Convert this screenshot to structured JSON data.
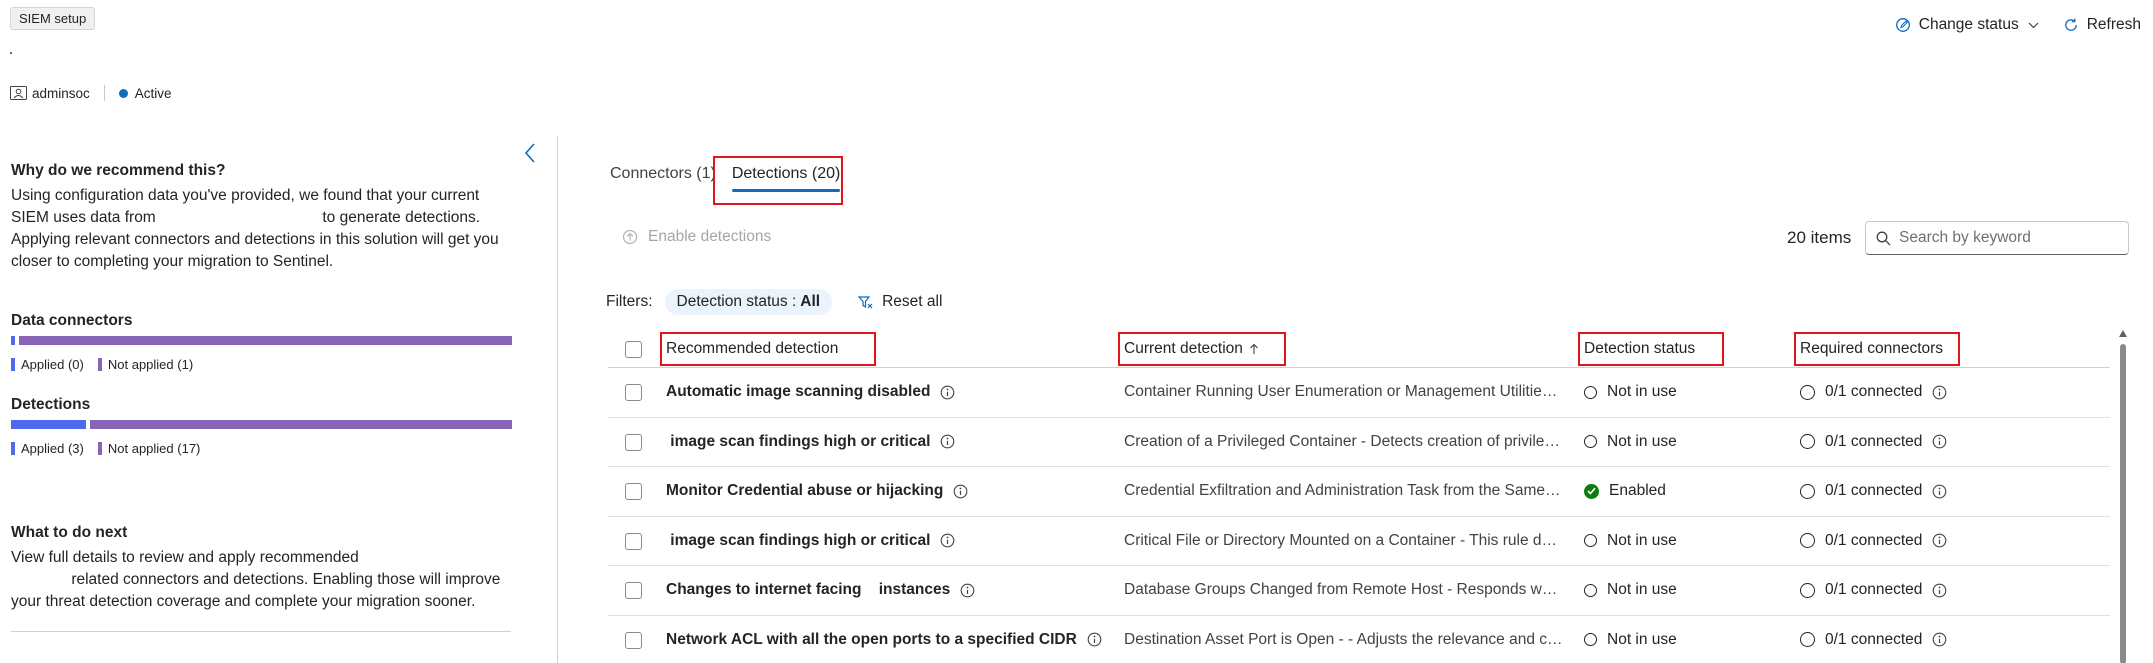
{
  "header": {
    "chip_label": "SIEM setup",
    "owner": "adminsoc",
    "status": "Active",
    "actions": {
      "change_status": "Change status",
      "refresh": "Refresh"
    }
  },
  "left_panel": {
    "why_heading": "Why do we recommend this?",
    "why_text_1": "Using configuration data you've provided, we found that your current SIEM uses data from",
    "why_text_2": "to generate detections. Applying relevant connectors and detections in this solution will get you closer to completing your migration to Sentinel.",
    "data_connectors": {
      "heading": "Data connectors",
      "applied_label": "Applied (0)",
      "not_applied_label": "Not applied (1)",
      "applied": 0,
      "not_applied": 1
    },
    "detections": {
      "heading": "Detections",
      "applied_label": "Applied (3)",
      "not_applied_label": "Not applied (17)",
      "applied": 3,
      "not_applied": 17
    },
    "next_heading": "What to do next",
    "next_text_1": "View full details to review and apply recommended",
    "next_text_2": "related connectors and detections. Enabling those will improve your threat detection coverage and complete your migration sooner."
  },
  "tabs": [
    {
      "label": "Connectors (1)",
      "active": false
    },
    {
      "label": "Detections (20)",
      "active": true
    }
  ],
  "toolbar": {
    "enable_label": "Enable detections",
    "items_count": "20 items",
    "search_placeholder": "Search by keyword"
  },
  "filters": {
    "label": "Filters:",
    "pill_key": "Detection status :",
    "pill_value": "All",
    "reset_label": "Reset all"
  },
  "table": {
    "columns": {
      "recommended": "Recommended detection",
      "current": "Current detection",
      "status": "Detection status",
      "required": "Required connectors"
    },
    "rows": [
      {
        "recommended": "Automatic image scanning disabled",
        "current": "Container Running User Enumeration or Management Utilities - Detects container running user enumeration or management utilities",
        "status": "Not in use",
        "enabled": false,
        "required": "0/1 connected"
      },
      {
        "recommended": " image scan findings high or critical",
        "current": "Creation of a Privileged Container - Detects creation of privileged containers",
        "status": "Not in use",
        "enabled": false,
        "required": "0/1 connected"
      },
      {
        "recommended": "Monitor Credential abuse or hijacking",
        "current": "Credential Exfiltration and Administration Task from the Same Host",
        "status": "Enabled",
        "enabled": true,
        "required": "0/1 connected"
      },
      {
        "recommended": " image scan findings high or critical",
        "current": "Critical File or Directory Mounted on a Container - This rule detects",
        "status": "Not in use",
        "enabled": false,
        "required": "0/1 connected"
      },
      {
        "recommended": "Changes to internet facing    instances",
        "current": "Database Groups Changed from Remote Host - Responds when database groups change",
        "status": "Not in use",
        "enabled": false,
        "required": "0/1 connected"
      },
      {
        "recommended": "Network ACL with all the open ports to a specified CIDR",
        "current": "Destination Asset Port is Open - - Adjusts the relevance and credibility",
        "status": "Not in use",
        "enabled": false,
        "required": "0/1 connected"
      }
    ]
  },
  "colors": {
    "accent": "#0f6cbd",
    "applied_bar": "#4f6bed",
    "not_applied_bar": "#8764b8",
    "highlight_box": "#e3151a",
    "enabled_green": "#107c10"
  }
}
